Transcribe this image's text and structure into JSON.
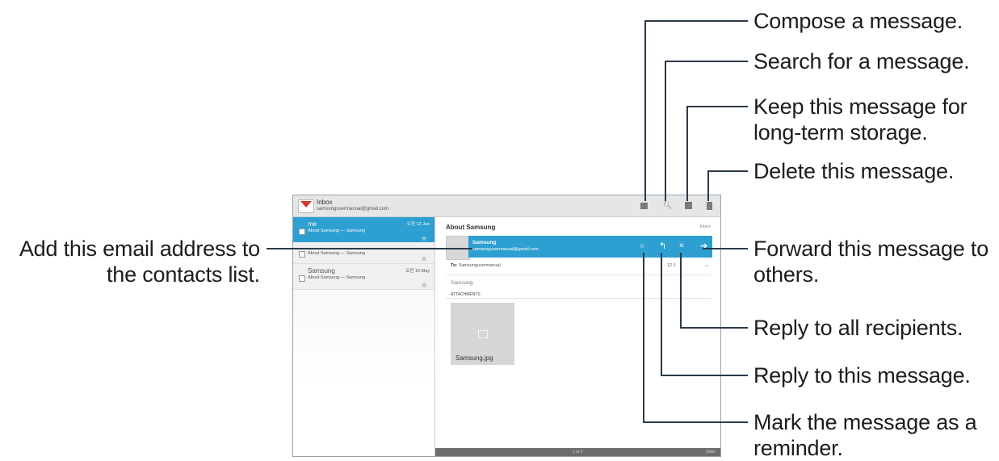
{
  "callouts": {
    "compose": "Compose a message.",
    "search": "Search for a message.",
    "archive_line1": "Keep this message for",
    "archive_line2": "long-term storage.",
    "delete": "Delete this message.",
    "forward_line1": "Forward this message to",
    "forward_line2": "others.",
    "reply_all": "Reply to all recipients.",
    "reply": "Reply to this message.",
    "reminder_line1": "Mark the message as a",
    "reminder_line2": "reminder.",
    "add_contact_line1": "Add this email address to",
    "add_contact_line2": "the contacts list."
  },
  "actionbar": {
    "title": "Inbox",
    "account": "samsungusermanual@gmail.com",
    "icons": [
      "compose-icon",
      "search-icon",
      "archive-icon",
      "delete-icon"
    ]
  },
  "list": {
    "items": [
      {
        "sender": "me",
        "snippet": "About Samsung — Samsung",
        "date": "오전 12 Jun",
        "selected": true
      },
      {
        "sender": "",
        "snippet": "About Samsung — Samsung",
        "date": "",
        "selected": false
      },
      {
        "sender": "Samsung",
        "snippet": "About Samsung — Samsung",
        "date": "오전 10 May",
        "selected": false
      }
    ]
  },
  "reader": {
    "subject": "About Samsung",
    "label": "Inbox",
    "sender_name": "Samsung",
    "sender_email": "samsungusermanual@gmail.com",
    "to_label": "To:",
    "to_value": "Samsungusermanual",
    "date": "12 J",
    "body": "Samsung",
    "attachments_label": "ATTACHMENTS",
    "attachment_name": "Samsung.jpg",
    "page_indicator": "1 of 3",
    "older_label": "Older"
  },
  "colors": {
    "accent": "#2d9fd0",
    "leader_line": "#2b3a4c"
  }
}
